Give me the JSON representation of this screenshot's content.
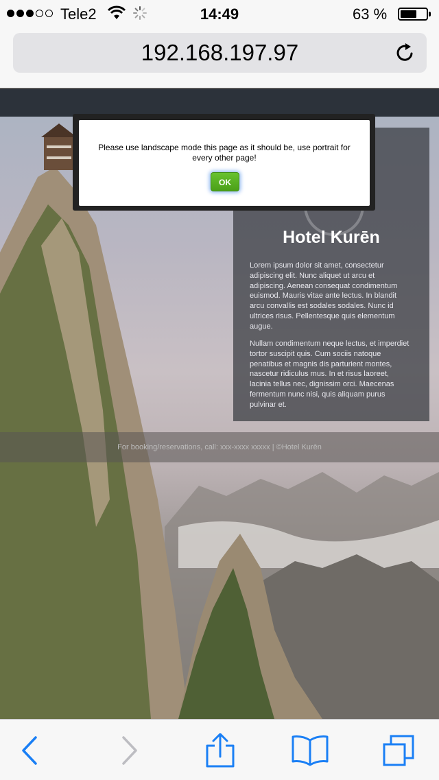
{
  "status_bar": {
    "carrier": "Tele2",
    "time": "14:49",
    "battery_percent": "63 %",
    "battery_level": 0.63,
    "signal_bars_filled": 3,
    "signal_bars_total": 5,
    "icons": [
      "wifi-icon",
      "loading-spinner-icon",
      "battery-icon"
    ]
  },
  "address_bar": {
    "url": "192.168.197.97",
    "reload_icon": "reload-icon"
  },
  "page": {
    "hotel_title": "Hotel Kurēn",
    "paragraph_1": "Lorem ipsum dolor sit amet, consectetur adipiscing elit. Nunc aliquet ut arcu et adipiscing. Aenean consequat condimentum euismod. Mauris vitae ante lectus. In blandit arcu convallis est sodales sodales. Nunc id ultrices risus. Pellentesque quis elementum augue.",
    "paragraph_2": "Nullam condimentum neque lectus, et imperdiet tortor suscipit quis. Cum sociis natoque penatibus et magnis dis parturient montes, nascetur ridiculus mus. In et risus laoreet, lacinia tellus nec, dignissim orci. Maecenas fermentum nunc nisi, quis aliquam purus pulvinar et.",
    "footer": "For booking/reservations, call: xxx-xxxx xxxxx | ©Hotel Kurēn"
  },
  "alert": {
    "message": "Please use landscape mode this page as it should be, use portrait for every other page!",
    "ok_label": "OK",
    "ok_color": "#5cb31f"
  },
  "toolbar": {
    "icons": [
      "back-icon",
      "forward-icon",
      "share-icon",
      "bookmarks-icon",
      "tabs-icon"
    ],
    "accent": "#1a7ff5",
    "disabled": "#bdbdc2"
  }
}
